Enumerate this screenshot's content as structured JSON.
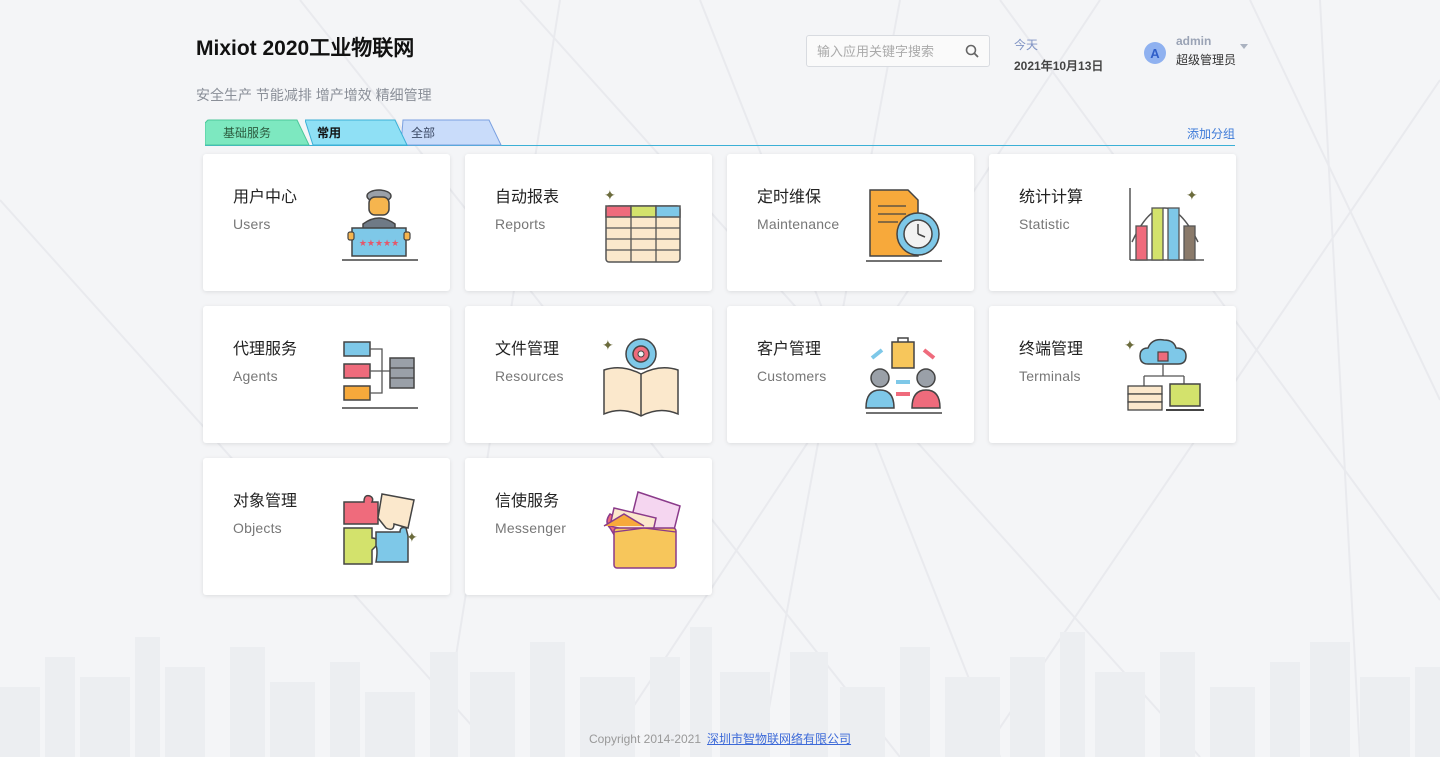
{
  "header": {
    "title": "Mixiot 2020工业物联网",
    "subtitle": "安全生产 节能减排 增产增效 精细管理"
  },
  "search": {
    "placeholder": "输入应用关键字搜索"
  },
  "date": {
    "label": "今天",
    "value": "2021年10月13日"
  },
  "user": {
    "avatar_letter": "A",
    "name": "admin",
    "role": "超级管理员"
  },
  "tabs": [
    {
      "label": "基础服务",
      "color": "#7de8c0"
    },
    {
      "label": "常用",
      "color": "#8fe0f5"
    },
    {
      "label": "全部",
      "color": "#c9dcfa"
    }
  ],
  "add_group_label": "添加分组",
  "apps": [
    {
      "title": "用户中心",
      "subtitle": "Users",
      "icon": "users-icon"
    },
    {
      "title": "自动报表",
      "subtitle": "Reports",
      "icon": "reports-icon"
    },
    {
      "title": "定时维保",
      "subtitle": "Maintenance",
      "icon": "maintenance-icon"
    },
    {
      "title": "统计计算",
      "subtitle": "Statistic",
      "icon": "statistic-icon"
    },
    {
      "title": "代理服务",
      "subtitle": "Agents",
      "icon": "agents-icon"
    },
    {
      "title": "文件管理",
      "subtitle": "Resources",
      "icon": "resources-icon"
    },
    {
      "title": "客户管理",
      "subtitle": "Customers",
      "icon": "customers-icon"
    },
    {
      "title": "终端管理",
      "subtitle": "Terminals",
      "icon": "terminals-icon"
    },
    {
      "title": "对象管理",
      "subtitle": "Objects",
      "icon": "objects-icon"
    },
    {
      "title": "信使服务",
      "subtitle": "Messenger",
      "icon": "messenger-icon"
    }
  ],
  "footer": {
    "copyright": "Copyright 2014-2021",
    "company_link": "深圳市智物联网络有限公司"
  }
}
